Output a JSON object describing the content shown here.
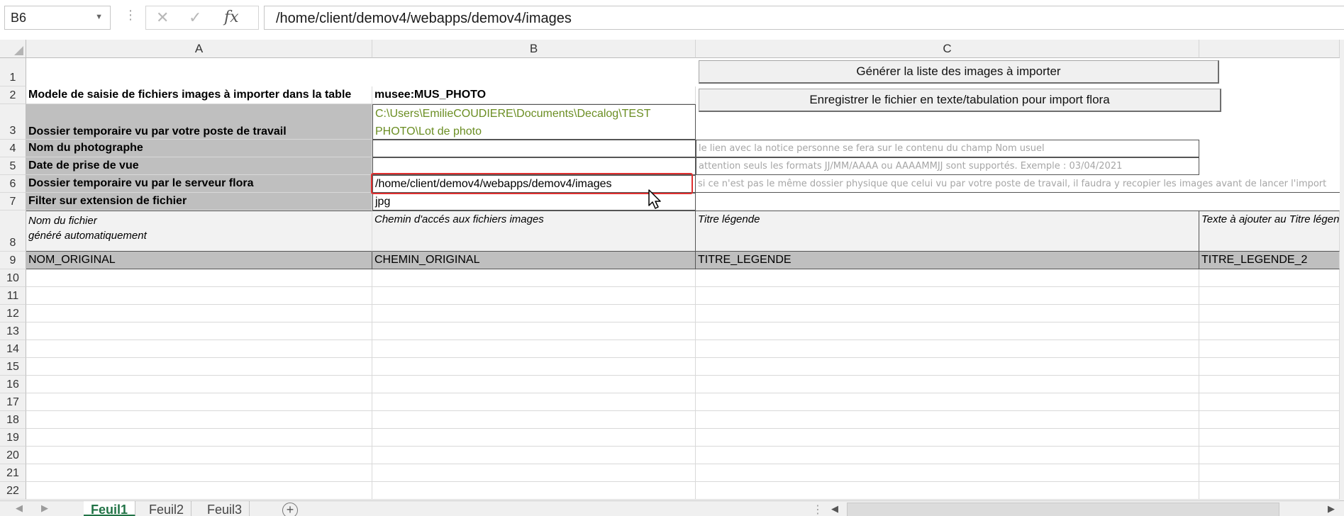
{
  "formula_bar": {
    "name_box": "B6",
    "dots": "⋮",
    "cancel_glyph": "✕",
    "enter_glyph": "✓",
    "fx": "fx",
    "formula": "/home/client/demov4/webapps/demov4/images"
  },
  "columns": [
    "A",
    "B",
    "C"
  ],
  "rows": [
    "1",
    "2",
    "3",
    "4",
    "5",
    "6",
    "7",
    "8",
    "9",
    "10",
    "11",
    "12",
    "13",
    "14",
    "15",
    "16",
    "17",
    "18",
    "19",
    "20",
    "21",
    "22"
  ],
  "buttons": {
    "generate": "Générer la liste des images à importer",
    "save_flora": "Enregistrer le fichier en texte/tabulation pour import flora"
  },
  "cells": {
    "A2": "Modele de saisie de fichiers images à importer dans la table",
    "B2": "musee:MUS_PHOTO",
    "A3": "Dossier temporaire vu par votre poste de travail",
    "B3_line1": "C:\\Users\\EmilieCOUDIERE\\Documents\\Decalog\\TEST",
    "B3_line2": "PHOTO\\Lot de photo",
    "A4": "Nom du photographe",
    "C4": "le lien avec la notice personne se fera sur le contenu du champ Nom usuel",
    "A5": "Date de prise de vue",
    "C5": "attention seuls les formats JJ/MM/AAAA ou AAAAMMJJ sont supportés. Exemple : 03/04/2021",
    "A6": "Dossier temporaire vu par le serveur flora",
    "B6": "/home/client/demov4/webapps/demov4/images",
    "C6": "si ce n'est pas le même dossier physique que celui vu par votre poste de travail, il faudra y recopier les images avant de lancer l'import",
    "A7": "Filter sur extension de fichier",
    "B7": "jpg",
    "A8_line1": "Nom du fichier",
    "A8_line2": "généré automatiquement",
    "B8": "Chemin d'accés aux fichiers  images",
    "C8": "Titre légende",
    "D8": "Texte à ajouter au Titre légende",
    "A9": "NOM_ORIGINAL",
    "B9": "CHEMIN_ORIGINAL",
    "C9": "TITRE_LEGENDE",
    "D9": "TITRE_LEGENDE_2"
  },
  "sheet_tabs": {
    "nav_prev": "◀",
    "nav_next": "▶",
    "tab1": "Feuil1",
    "tab2": "Feuil2",
    "tab3": "Feuil3",
    "add": "+",
    "scroll_left": "◀",
    "scroll_right": "▶",
    "dots": "⋮"
  },
  "colors": {
    "accent_green": "#217346",
    "selection_red": "#e03030",
    "label_gray_fill": "#bfbfbf",
    "path_green": "#6b8e23"
  }
}
